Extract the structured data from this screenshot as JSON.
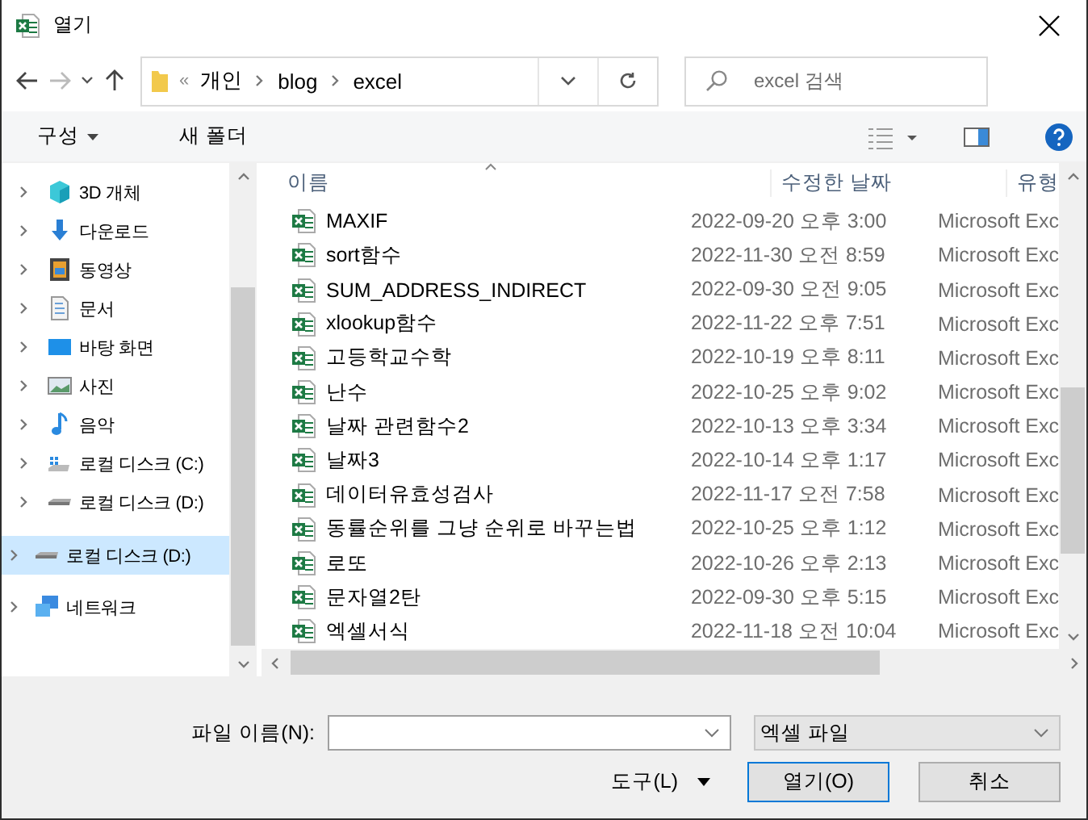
{
  "window": {
    "title": "열기"
  },
  "address": {
    "overflow": "«",
    "crumbs": [
      "개인",
      "blog",
      "excel"
    ]
  },
  "search": {
    "placeholder": "excel 검색"
  },
  "toolbar": {
    "organize": "구성",
    "new_folder": "새 폴더"
  },
  "nav": {
    "nested_items": [
      {
        "label": "3D 개체",
        "kind": "cube",
        "selected": false
      },
      {
        "label": "다운로드",
        "kind": "download",
        "selected": false
      },
      {
        "label": "동영상",
        "kind": "video",
        "selected": false
      },
      {
        "label": "문서",
        "kind": "document",
        "selected": false
      },
      {
        "label": "바탕 화면",
        "kind": "desktop",
        "selected": false
      },
      {
        "label": "사진",
        "kind": "photo",
        "selected": false
      },
      {
        "label": "음악",
        "kind": "music",
        "selected": false
      },
      {
        "label": "로컬 디스크 (C:)",
        "kind": "system-drive",
        "selected": false
      },
      {
        "label": "로컬 디스크 (D:)",
        "kind": "drive",
        "selected": false
      }
    ],
    "items": [
      {
        "label": "로컬 디스크 (D:)",
        "kind": "drive",
        "selected": true
      },
      {
        "label": "네트워크",
        "kind": "network",
        "selected": false
      }
    ]
  },
  "table": {
    "columns": [
      "이름",
      "수정한 날짜",
      "유형"
    ],
    "rows": [
      {
        "name": "MAXIF",
        "date": "2022-09-20 오후 3:00",
        "type": "Microsoft Exc"
      },
      {
        "name": "sort함수",
        "date": "2022-11-30 오전 8:59",
        "type": "Microsoft Exc"
      },
      {
        "name": "SUM_ADDRESS_INDIRECT",
        "date": "2022-09-30 오전 9:05",
        "type": "Microsoft Exc"
      },
      {
        "name": "xlookup함수",
        "date": "2022-11-22 오후 7:51",
        "type": "Microsoft Exc"
      },
      {
        "name": "고등학교수학",
        "date": "2022-10-19 오후 8:11",
        "type": "Microsoft Exc"
      },
      {
        "name": "난수",
        "date": "2022-10-25 오후 9:02",
        "type": "Microsoft Exc"
      },
      {
        "name": "날짜 관련함수2",
        "date": "2022-10-13 오후 3:34",
        "type": "Microsoft Exc"
      },
      {
        "name": "날짜3",
        "date": "2022-10-14 오후 1:17",
        "type": "Microsoft Exc"
      },
      {
        "name": "데이터유효성검사",
        "date": "2022-11-17 오전 7:58",
        "type": "Microsoft Exc"
      },
      {
        "name": "동률순위를 그냥 순위로 바꾸는법",
        "date": "2022-10-25 오후 1:12",
        "type": "Microsoft Exc"
      },
      {
        "name": "로또",
        "date": "2022-10-26 오후 2:13",
        "type": "Microsoft Exc"
      },
      {
        "name": "문자열2탄",
        "date": "2022-09-30 오후 5:15",
        "type": "Microsoft Exc"
      },
      {
        "name": "엑셀서식",
        "date": "2022-11-18 오전 10:04",
        "type": "Microsoft Exc"
      }
    ]
  },
  "footer": {
    "filename_label": "파일 이름(N):",
    "filter": "엑셀 파일",
    "tools": "도구(L)",
    "open": "열기(O)",
    "cancel": "취소"
  }
}
